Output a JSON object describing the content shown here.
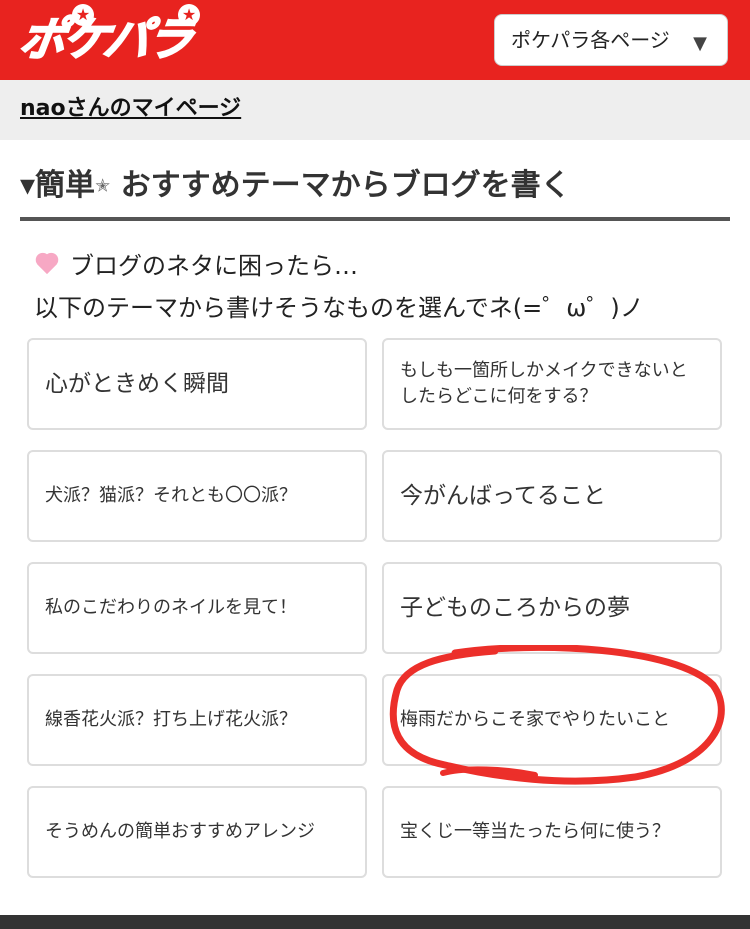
{
  "header": {
    "logo_text": "ポケパラ",
    "page_select_label": "ポケパラ各ページ",
    "colors": {
      "brand": "#e8231f"
    }
  },
  "subbar": {
    "mypage_link": "naoさんのマイページ"
  },
  "section": {
    "title": "▾簡単",
    "title_star": "✭",
    "title_rest": " おすすめテーマからブログを書く",
    "intro_line1": "ブログのネタに困ったら…",
    "intro_line2": "以下のテーマから書けそうなものを選んでネ(=゜ω゜)ノ"
  },
  "themes": [
    {
      "label": "心がときめく瞬間"
    },
    {
      "label": "もしも一箇所しかメイクできないとしたらどこに何をする？"
    },
    {
      "label": "犬派？猫派？それとも〇〇派？"
    },
    {
      "label": "今がんばってること"
    },
    {
      "label": "私のこだわりのネイルを見て！"
    },
    {
      "label": "子どものころからの夢"
    },
    {
      "label": "線香花火派？打ち上げ花火派？"
    },
    {
      "label": "梅雨だからこそ家でやりたいこと"
    },
    {
      "label": "そうめんの簡単おすすめアレンジ"
    },
    {
      "label": "宝くじ一等当たったら何に使う？"
    }
  ],
  "annotation": {
    "highlight_color": "#ec2f2a",
    "highlighted_theme": "梅雨だからこそ家でやりたいこと"
  }
}
